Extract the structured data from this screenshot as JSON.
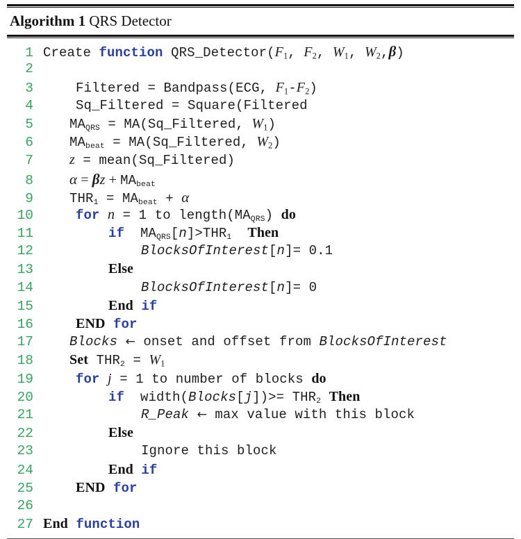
{
  "title": {
    "label": "Algorithm 1",
    "name": "QRS Detector"
  },
  "colors": {
    "line_number": "#36a35f",
    "keyword_blue": "#2b3f9e",
    "text": "#1e1e1e",
    "rule": "#111111"
  },
  "code": {
    "lines": [
      {
        "n": "1",
        "text": "Create function QRS_Detector(F1, F2, W1, W2, β)"
      },
      {
        "n": "2",
        "text": ""
      },
      {
        "n": "3",
        "text": "Filtered = Bandpass(ECG, F1-F2)"
      },
      {
        "n": "4",
        "text": "Sq_Filtered = Square(Filtered"
      },
      {
        "n": "5",
        "text": "MAQRS = MA(Sq_Filtered, W1)"
      },
      {
        "n": "6",
        "text": "MAbeat = MA(Sq_Filtered, W2)"
      },
      {
        "n": "7",
        "text": "z = mean(Sq_Filtered)"
      },
      {
        "n": "8",
        "text": "α = βz + MAbeat"
      },
      {
        "n": "9",
        "text": "THR1 = MAbeat + α"
      },
      {
        "n": "10",
        "text": "for n = 1 to length(MAQRS) do"
      },
      {
        "n": "11",
        "text": "if  MAQRS[n]>THR1   Then"
      },
      {
        "n": "12",
        "text": "BlocksOfInterest[n]= 0.1"
      },
      {
        "n": "13",
        "text": "Else"
      },
      {
        "n": "14",
        "text": "BlocksOfInterest[n]= 0"
      },
      {
        "n": "15",
        "text": "End if"
      },
      {
        "n": "16",
        "text": "END for"
      },
      {
        "n": "17",
        "text": "Blocks ← onset and offset from BlocksOfInterest"
      },
      {
        "n": "18",
        "text": "Set THR2 = W1"
      },
      {
        "n": "19",
        "text": "for j = 1 to number of blocks do"
      },
      {
        "n": "20",
        "text": "if  width(Blocks[j])>= THR2 Then"
      },
      {
        "n": "21",
        "text": "R_Peak ← max value with this block"
      },
      {
        "n": "22",
        "text": "Else"
      },
      {
        "n": "23",
        "text": "Ignore this block"
      },
      {
        "n": "24",
        "text": "End if"
      },
      {
        "n": "25",
        "text": "END for"
      },
      {
        "n": "26",
        "text": ""
      },
      {
        "n": "27",
        "text": "End function"
      }
    ],
    "tokens": {
      "create": "Create",
      "function": "function",
      "qrs_detector": "QRS_Detector",
      "filtered": "Filtered",
      "bandpass": "Bandpass",
      "ecg": "ECG",
      "sq_filtered": "Sq_Filtered",
      "square": "Square",
      "ma": "MA",
      "mean": "mean",
      "thr": "THR",
      "for": "for",
      "to": "to",
      "length": "length",
      "do": "do",
      "if": "if",
      "then": "Then",
      "else": "Else",
      "end": "End",
      "end_caps": "END",
      "set": "Set",
      "blocks_of_interest": "BlocksOfInterest",
      "blocks": "Blocks",
      "width": "width",
      "r_peak": "R_Peak",
      "onset_offset": "onset and offset from",
      "number_of_blocks": "number of blocks",
      "max_value": "max value with this block",
      "ignore": "Ignore this block",
      "val_point_one": "0.1",
      "val_zero": "0",
      "one": "1",
      "sub_qrs": "QRS",
      "sub_beat": "beat",
      "var_n": "n",
      "var_j": "j",
      "var_z": "z",
      "var_F": "F",
      "var_W": "W",
      "greek_alpha": "α",
      "greek_beta": "β",
      "arrow": "←"
    }
  }
}
